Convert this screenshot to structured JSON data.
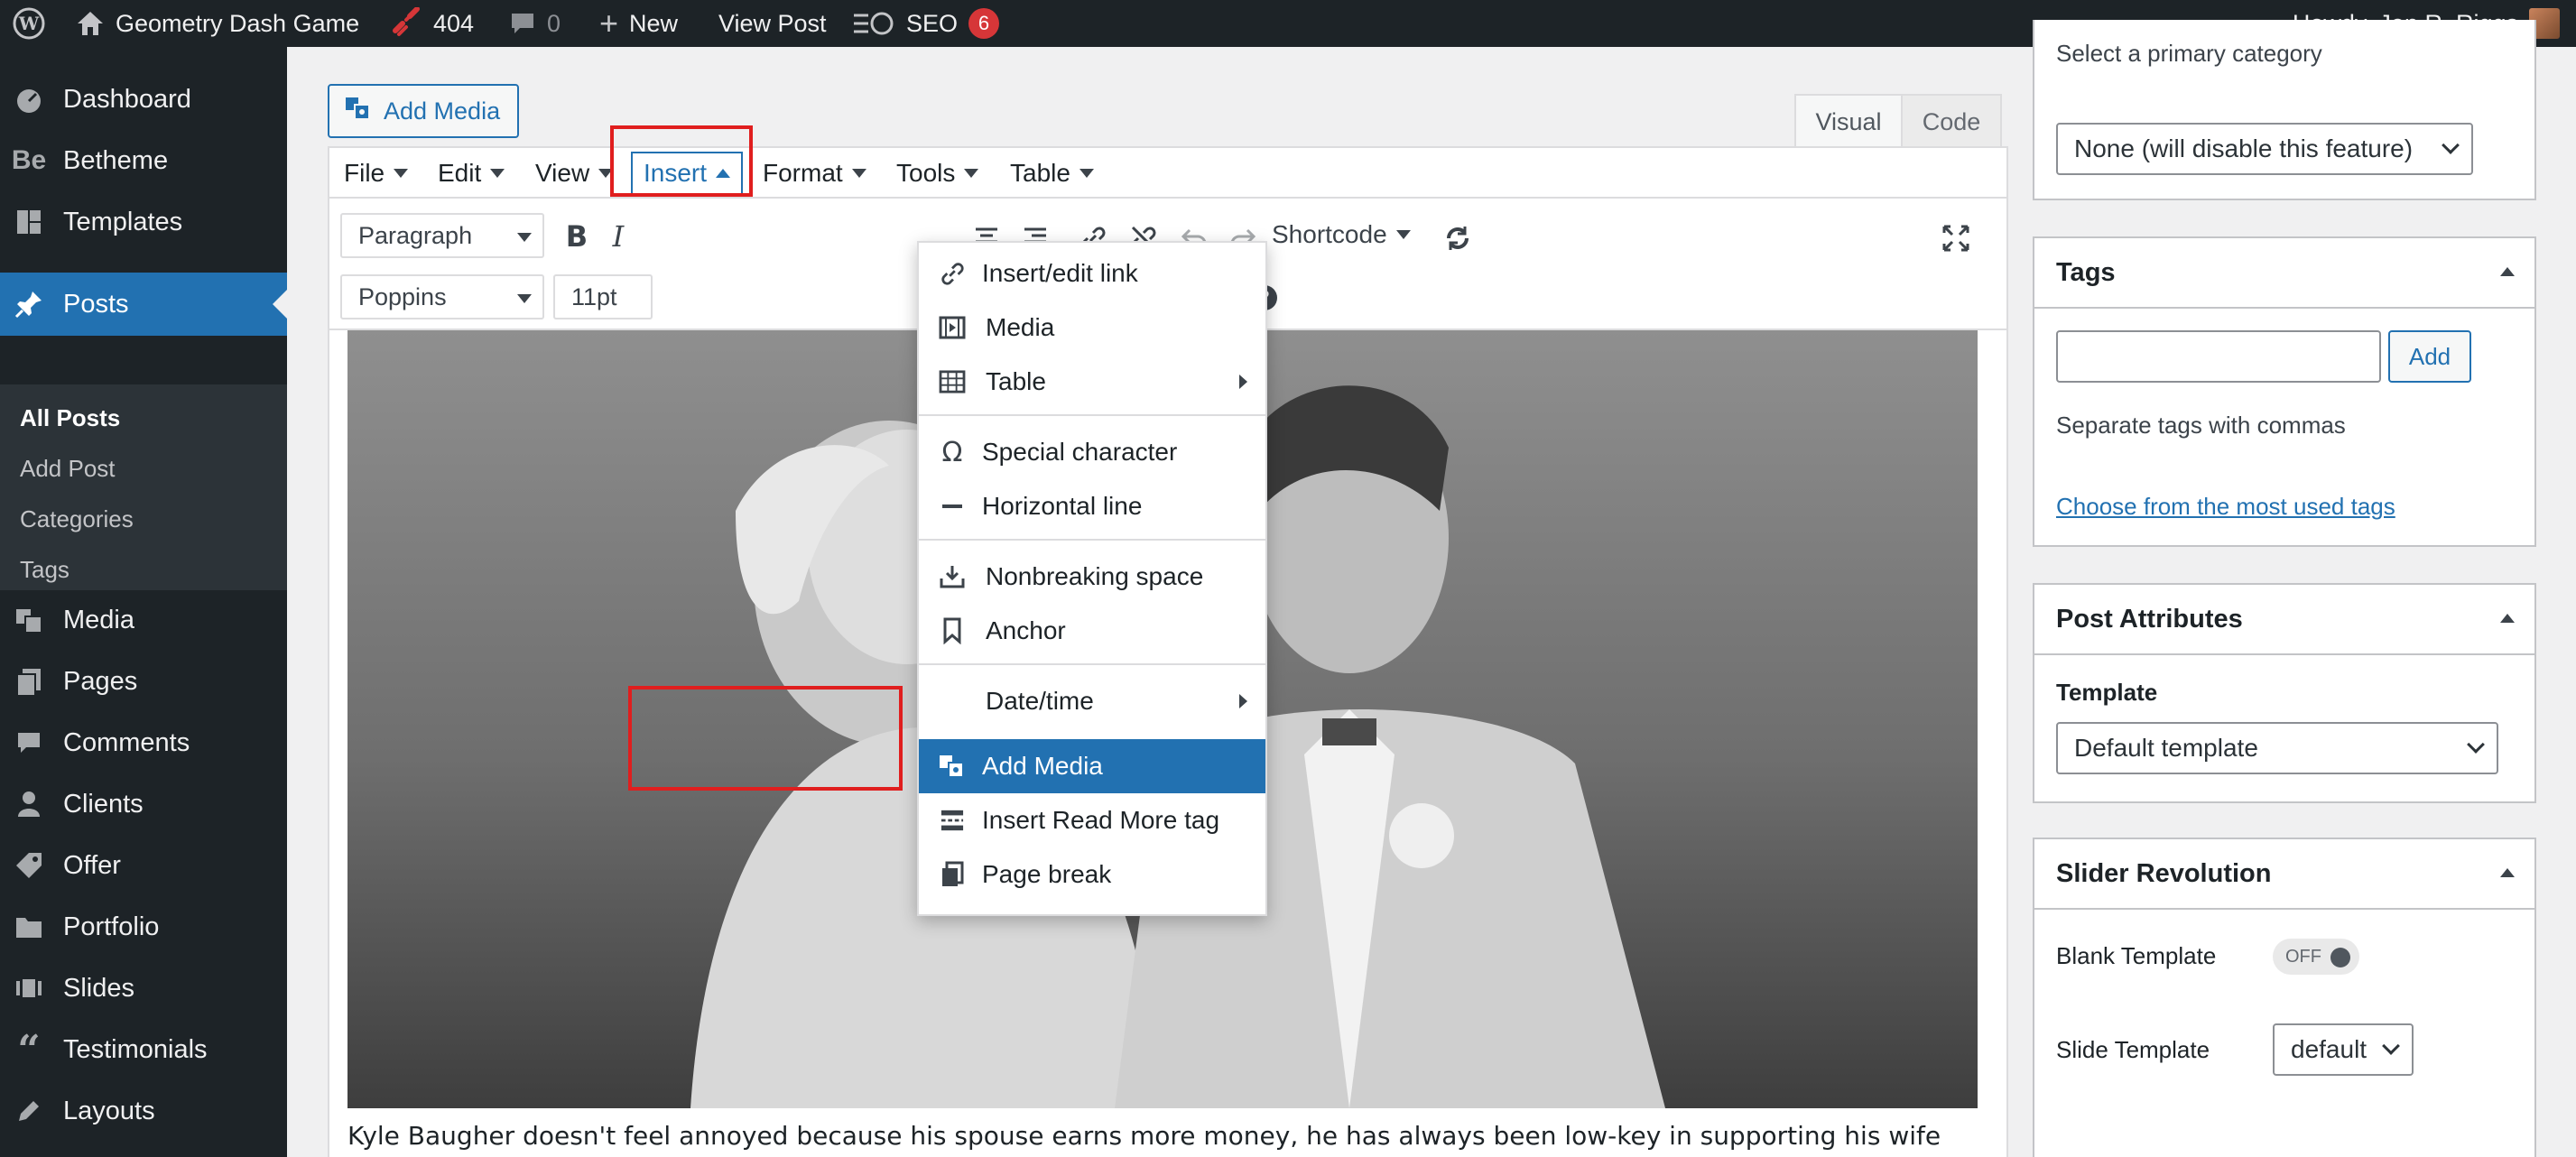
{
  "adminbar": {
    "site_name": "Geometry Dash Game",
    "broken_links_count": "404",
    "comments_count": "0",
    "new_label": "New",
    "view_post_label": "View Post",
    "seo_label": "SEO",
    "seo_badge": "6",
    "howdy": "Howdy, Jen R. Riggs"
  },
  "sidebar": {
    "items": [
      {
        "label": "Dashboard",
        "icon": "dashboard-icon"
      },
      {
        "label": "Betheme",
        "icon": "betheme-icon"
      },
      {
        "label": "Templates",
        "icon": "templates-icon"
      },
      {
        "label": "Posts",
        "icon": "pin-icon"
      },
      {
        "label": "Media",
        "icon": "media-icon"
      },
      {
        "label": "Pages",
        "icon": "pages-icon"
      },
      {
        "label": "Comments",
        "icon": "comments-icon"
      },
      {
        "label": "Clients",
        "icon": "clients-icon"
      },
      {
        "label": "Offer",
        "icon": "offer-icon"
      },
      {
        "label": "Portfolio",
        "icon": "portfolio-icon"
      },
      {
        "label": "Slides",
        "icon": "slides-icon"
      },
      {
        "label": "Testimonials",
        "icon": "quote-icon"
      },
      {
        "label": "Layouts",
        "icon": "layouts-icon"
      }
    ],
    "posts_submenu": [
      "All Posts",
      "Add Post",
      "Categories",
      "Tags"
    ]
  },
  "editor": {
    "add_media_label": "Add Media",
    "tab_visual": "Visual",
    "tab_code": "Code",
    "menubar": [
      "File",
      "Edit",
      "View",
      "Insert",
      "Format",
      "Tools",
      "Table"
    ],
    "format_select": "Paragraph",
    "font_select": "Poppins",
    "size_select": "11pt",
    "shortcode_label": "Shortcode",
    "body_text": "Kyle Baugher doesn't feel annoyed because his spouse earns more money, he has always been low-key in supporting his wife"
  },
  "insert_menu": {
    "items": [
      {
        "label": "Insert/edit link",
        "icon": "link-icon"
      },
      {
        "label": "Media",
        "icon": "film-icon"
      },
      {
        "label": "Table",
        "icon": "table-icon",
        "submenu": true
      },
      {
        "label": "Special character",
        "icon": "omega-icon"
      },
      {
        "label": "Horizontal line",
        "icon": "hr-icon"
      },
      {
        "label": "Nonbreaking space",
        "icon": "nbsp-icon"
      },
      {
        "label": "Anchor",
        "icon": "bookmark-icon"
      },
      {
        "label": "Date/time",
        "icon": "",
        "submenu": true
      },
      {
        "label": "Add Media",
        "icon": "add-media-icon",
        "highlighted": true
      },
      {
        "label": "Insert Read More tag",
        "icon": "readmore-icon"
      },
      {
        "label": "Page break",
        "icon": "pagebreak-icon"
      }
    ]
  },
  "right": {
    "category_label": "Select a primary category",
    "category_value": "None (will disable this feature)",
    "tags_title": "Tags",
    "tags_add": "Add",
    "tags_hint": "Separate tags with commas",
    "tags_link": "Choose from the most used tags",
    "attributes_title": "Post Attributes",
    "template_label": "Template",
    "template_value": "Default template",
    "slider_title": "Slider Revolution",
    "blank_template_label": "Blank Template",
    "blank_template_state": "OFF",
    "slide_template_label": "Slide Template",
    "slide_template_value": "default"
  },
  "colors": {
    "admin_dark": "#1d2327",
    "accent": "#2271b1",
    "highlight_box": "#e01e1e",
    "badge": "#d63638"
  }
}
